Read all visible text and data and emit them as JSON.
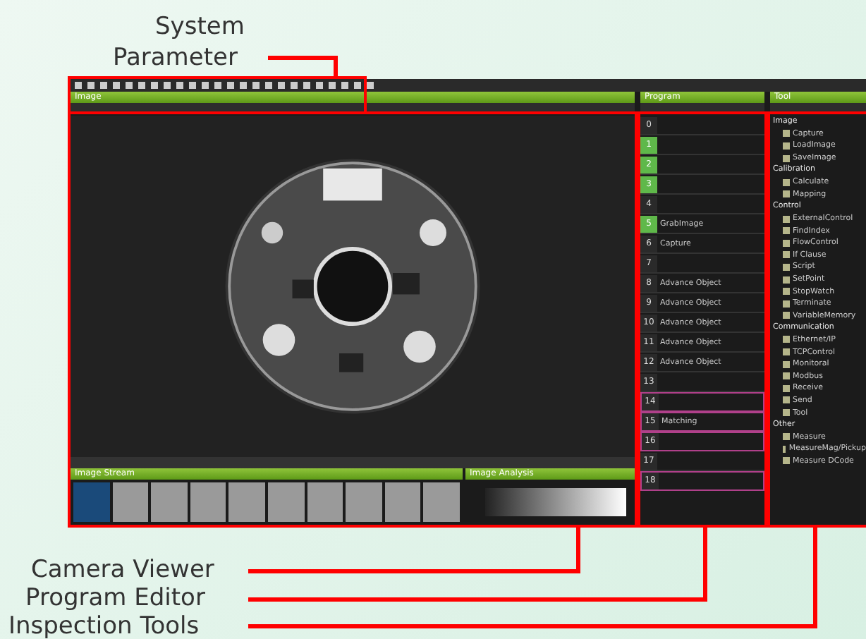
{
  "callouts": [
    {
      "label": "System Parameter"
    },
    {
      "label": "Camera Viewer"
    },
    {
      "label": "Program Editor"
    },
    {
      "label": "Inspection Tools"
    }
  ],
  "viewer": {
    "title": "Image",
    "stream_title": "Image Stream",
    "analysis_title": "Image Analysis"
  },
  "program": {
    "title": "Program",
    "steps": [
      {
        "number": "0",
        "active": false,
        "grouped": false
      },
      {
        "number": "1",
        "active": true,
        "grouped": false
      },
      {
        "number": "2",
        "active": true,
        "grouped": false
      },
      {
        "number": "3",
        "active": true,
        "grouped": false
      },
      {
        "number": "4",
        "active": false,
        "grouped": false
      },
      {
        "number": "5",
        "name": "GrabImage",
        "active": true,
        "grouped": false
      },
      {
        "number": "6",
        "name": "Capture",
        "active": false,
        "grouped": false
      },
      {
        "number": "7",
        "active": false,
        "grouped": false
      },
      {
        "number": "8",
        "name": "Advance Object",
        "active": false,
        "grouped": false
      },
      {
        "number": "9",
        "name": "Advance Object",
        "active": false,
        "grouped": false
      },
      {
        "number": "10",
        "name": "Advance Object",
        "active": false,
        "grouped": false
      },
      {
        "number": "11",
        "name": "Advance Object",
        "active": false,
        "grouped": false
      },
      {
        "number": "12",
        "name": "Advance Object",
        "active": false,
        "grouped": false
      },
      {
        "number": "13",
        "active": false,
        "grouped": false
      },
      {
        "number": "14",
        "active": false,
        "grouped": true
      },
      {
        "number": "15",
        "name": "Matching",
        "active": false,
        "grouped": true
      },
      {
        "number": "16",
        "active": false,
        "grouped": true
      },
      {
        "number": "17",
        "active": false,
        "grouped": false
      },
      {
        "number": "18",
        "active": false,
        "grouped": true
      }
    ]
  },
  "tools": {
    "title": "Tool",
    "groups": [
      {
        "name": "Image",
        "items": [
          "Capture",
          "LoadImage",
          "SaveImage"
        ]
      },
      {
        "name": "Calibration",
        "items": [
          "Calculate",
          "Mapping"
        ]
      },
      {
        "name": "Control",
        "items": [
          "ExternalControl",
          "FindIndex",
          "FlowControl",
          "If Clause",
          "Script",
          "SetPoint",
          "StopWatch",
          "Terminate",
          "VariableMemory"
        ]
      },
      {
        "name": "Communication",
        "items": [
          "Ethernet/IP",
          "TCPControl",
          "Monitoral",
          "Modbus",
          "Receive",
          "Send",
          "Tool"
        ]
      },
      {
        "name": "Other",
        "items": [
          "Measure",
          "MeasureMag/Pickup",
          "Measure DCode"
        ]
      }
    ]
  }
}
